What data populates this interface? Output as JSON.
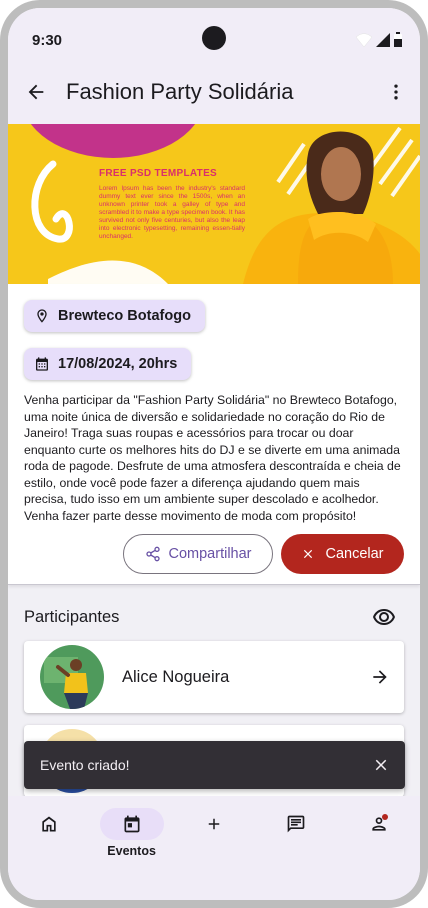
{
  "status_bar": {
    "time": "9:30"
  },
  "app_bar": {
    "title": "Fashion Party Solidária"
  },
  "banner": {
    "heading": "FREE PSD TEMPLATES",
    "body": "Lorem Ipsum has been the industry's standard dummy text ever since the 1500s, when an unknown printer took a galley of type and scrambled it to make a type specimen book. It has survived not only five centuries, but also the leap into electronic typesetting, remaining essen-tially unchanged."
  },
  "event": {
    "location": "Brewteco Botafogo",
    "datetime": "17/08/2024, 20hrs",
    "description": "Venha participar da \"Fashion Party Solidária\" no Brewteco Botafogo, uma noite única de diversão e solidariedade no coração do Rio de Janeiro! Traga suas roupas e acessórios para trocar ou doar enquanto curte os melhores hits do DJ e se diverte em uma animada roda de pagode. Desfrute de uma atmosfera descontraída e cheia de estilo, onde você pode fazer a diferença ajudando quem mais precisa, tudo isso em um ambiente super descolado e acolhedor. Venha fazer parte desse movimento de moda com propósito!",
    "share_label": "Compartilhar",
    "cancel_label": "Cancelar"
  },
  "participants": {
    "title": "Participantes",
    "items": [
      {
        "name": "Alice Nogueira"
      },
      {
        "name": ""
      }
    ]
  },
  "snackbar": {
    "message": "Evento criado!"
  },
  "nav": {
    "items": [
      {
        "icon": "home-icon",
        "label": ""
      },
      {
        "icon": "calendar-icon",
        "label": "Eventos",
        "active": true
      },
      {
        "icon": "plus-icon",
        "label": ""
      },
      {
        "icon": "chat-icon",
        "label": ""
      },
      {
        "icon": "person-icon",
        "label": ""
      }
    ]
  },
  "colors": {
    "primary": "#6750a4",
    "danger": "#b3261e",
    "chip_bg": "#e7defa",
    "bar_bg": "#f1edf7",
    "banner_yellow": "#f6c71a",
    "banner_pink": "#d9306a"
  }
}
